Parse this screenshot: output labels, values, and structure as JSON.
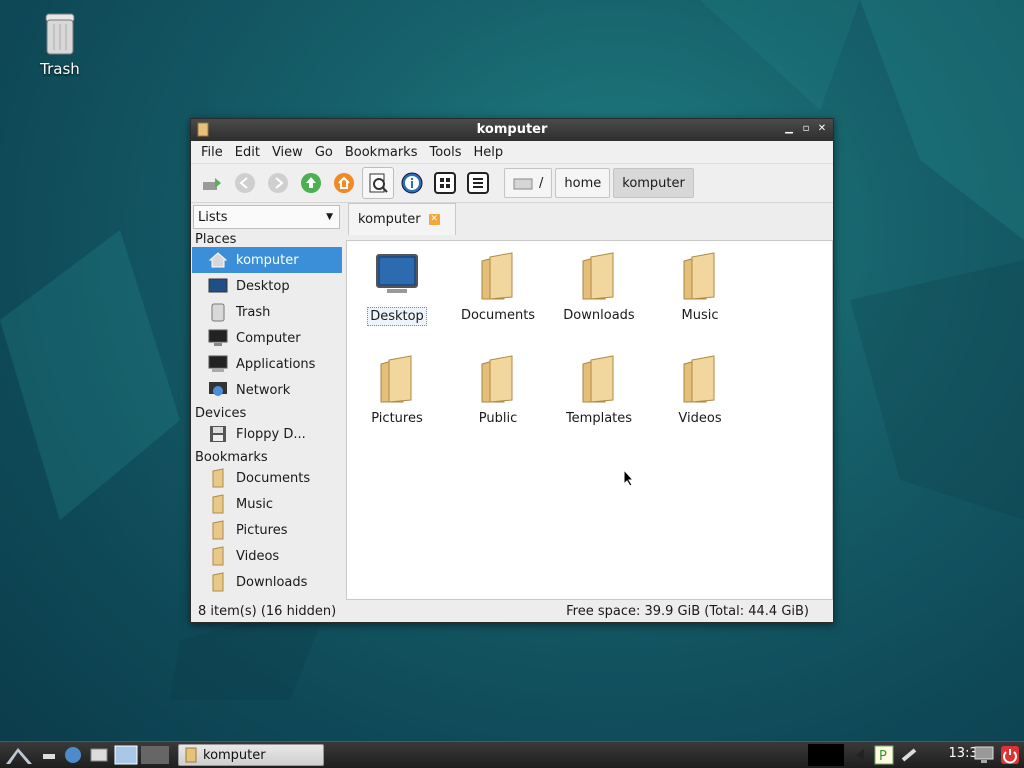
{
  "desktop": {
    "trash_label": "Trash"
  },
  "window": {
    "title": "komputer",
    "menu": [
      "File",
      "Edit",
      "View",
      "Go",
      "Bookmarks",
      "Tools",
      "Help"
    ],
    "breadcrumbs": [
      "/",
      "home",
      "komputer"
    ],
    "side_mode": "Lists",
    "places_heading": "Places",
    "places": [
      "komputer",
      "Desktop",
      "Trash",
      "Computer",
      "Applications",
      "Network"
    ],
    "devices_heading": "Devices",
    "devices": [
      "Floppy D..."
    ],
    "bookmarks_heading": "Bookmarks",
    "bookmarks": [
      "Documents",
      "Music",
      "Pictures",
      "Videos",
      "Downloads"
    ],
    "tab_label": "komputer",
    "files": [
      "Desktop",
      "Documents",
      "Downloads",
      "Music",
      "Pictures",
      "Public",
      "Templates",
      "Videos"
    ],
    "status_left": "8 item(s) (16 hidden)",
    "status_right": "Free space: 39.9 GiB (Total: 44.4 GiB)"
  },
  "taskbar": {
    "task_label": "komputer",
    "clock": "13:30"
  },
  "colors": {
    "selection": "#3b8fd8",
    "desktop": "#16606a"
  }
}
